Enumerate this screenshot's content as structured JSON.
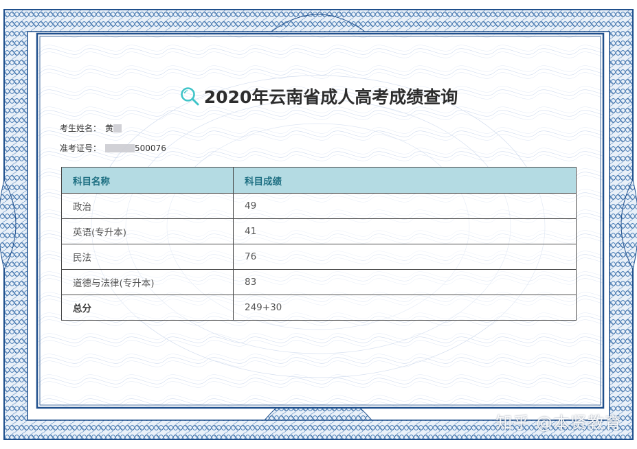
{
  "document": {
    "title": "2020年云南省成人高考成绩查询",
    "icon": "search-icon",
    "colors": {
      "border": "#1f4f8c",
      "header_bg": "#b4dbe3",
      "header_text": "#1e6f82",
      "icon": "#3fc4c8"
    },
    "candidate": {
      "name_label": "考生姓名：",
      "name_value": "黄",
      "id_label": "准考证号：",
      "id_value_visible": "500076"
    },
    "table": {
      "headers": [
        "科目名称",
        "科目成绩"
      ],
      "rows": [
        {
          "subject": "政治",
          "score": "49"
        },
        {
          "subject": "英语(专升本)",
          "score": "41"
        },
        {
          "subject": "民法",
          "score": "76"
        },
        {
          "subject": "道德与法律(专升本)",
          "score": "83"
        }
      ],
      "total": {
        "label": "总分",
        "score": "249+30"
      }
    },
    "watermark": "知乎 @本贤教育"
  }
}
